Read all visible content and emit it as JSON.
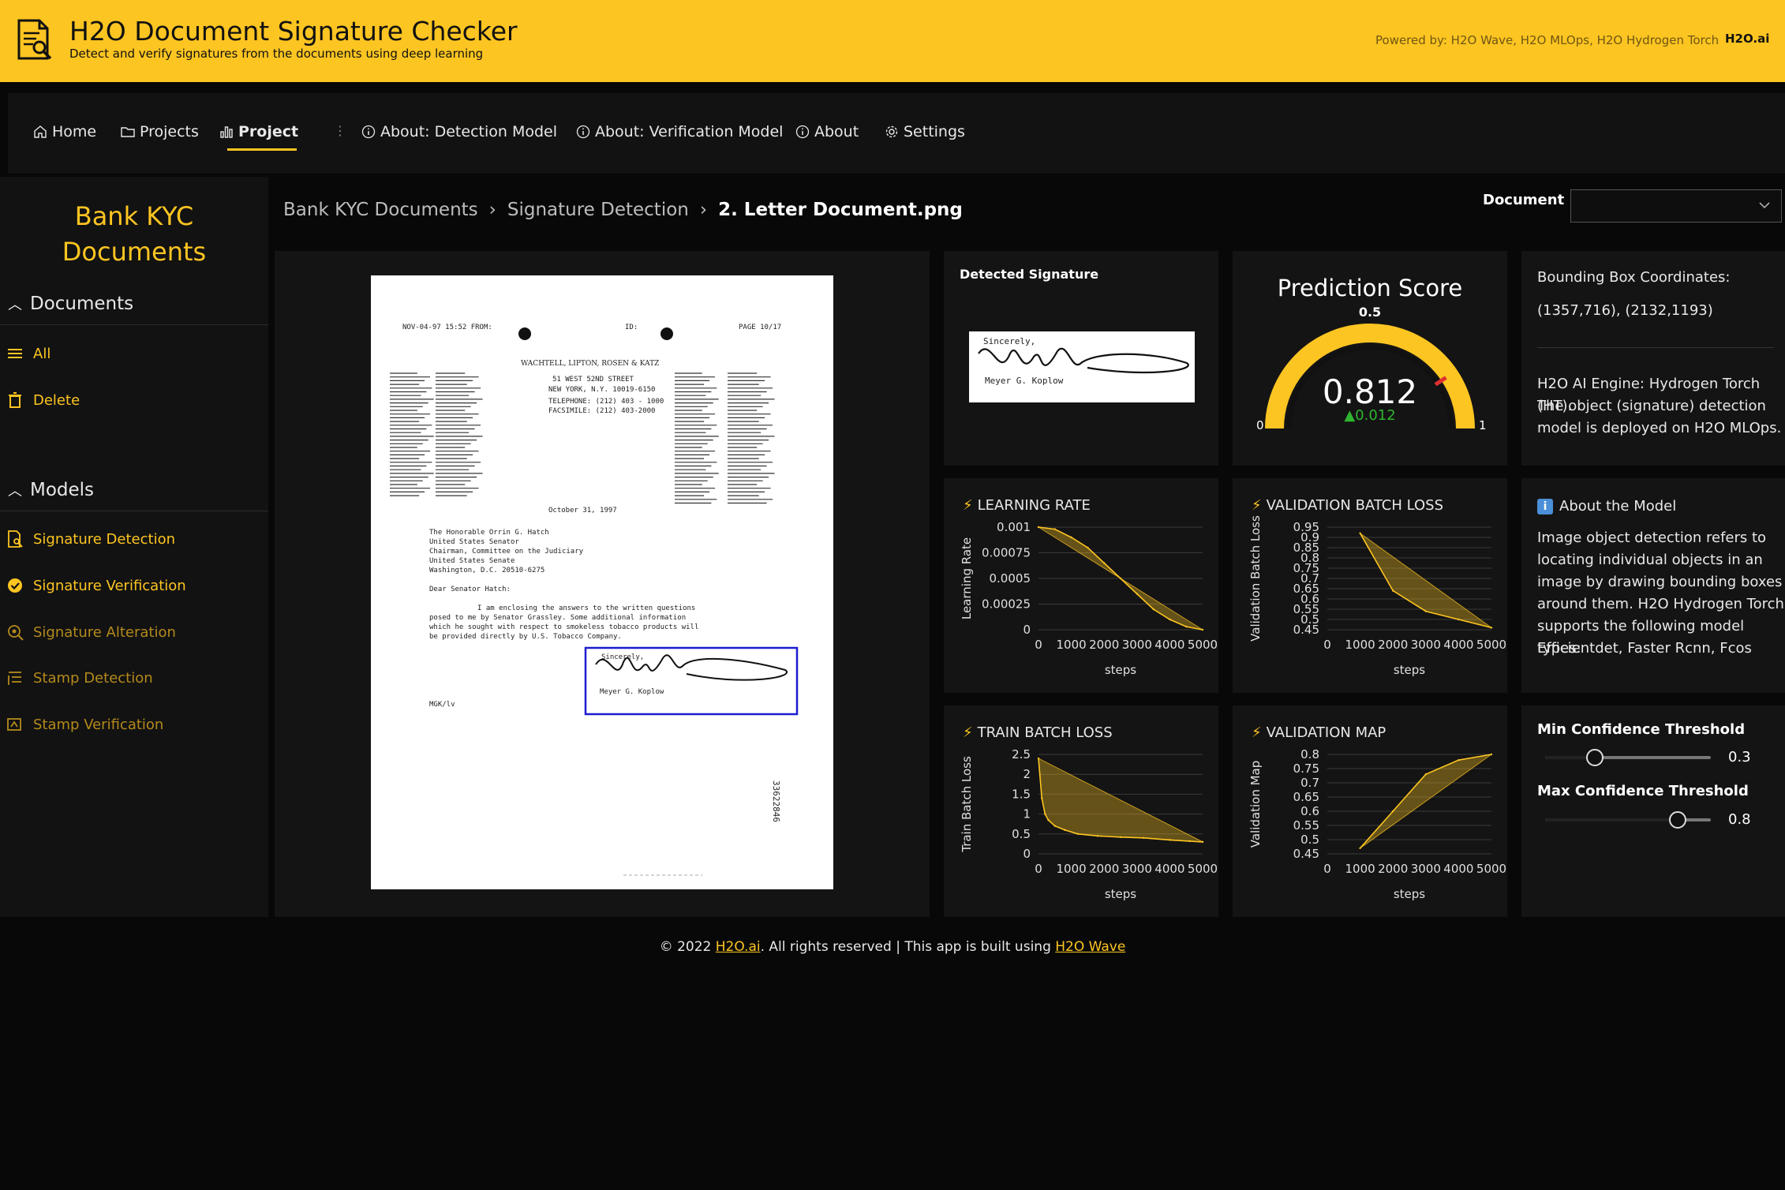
{
  "header": {
    "title": "H2O Document Signature Checker",
    "subtitle": "Detect and verify signatures from the documents using deep learning",
    "powered_by": "Powered by: H2O Wave, H2O MLOps, H2O Hydrogen Torch",
    "brand": "H2O.ai",
    "accent": "#fdc521"
  },
  "nav": {
    "items": [
      {
        "label": "Home",
        "icon": "home-icon"
      },
      {
        "label": "Projects",
        "icon": "folder-icon"
      },
      {
        "label": "Project",
        "icon": "bar-chart-icon",
        "active": true
      },
      {
        "label": "About: Detection Model",
        "icon": "info-icon"
      },
      {
        "label": "About: Verification Model",
        "icon": "info-icon"
      },
      {
        "label": "About",
        "icon": "info-icon"
      },
      {
        "label": "Settings",
        "icon": "gear-icon"
      }
    ]
  },
  "sidebar": {
    "title": "Bank KYC Documents",
    "documents_header": "Documents",
    "doc_links": [
      {
        "label": "All",
        "icon": "list-icon"
      },
      {
        "label": "Delete",
        "icon": "trash-icon"
      }
    ],
    "models_header": "Models",
    "model_links": [
      {
        "label": "Signature Detection",
        "icon": "document-search-icon"
      },
      {
        "label": "Signature Verification",
        "icon": "verified-badge-icon"
      },
      {
        "label": "Signature Alteration",
        "icon": "eye-search-icon"
      },
      {
        "label": "Stamp Detection",
        "icon": "stamp-list-icon"
      },
      {
        "label": "Stamp Verification",
        "icon": "stamp-verify-icon"
      }
    ]
  },
  "breadcrumb": [
    "Bank KYC Documents",
    "Signature Detection",
    "2. Letter Document.png"
  ],
  "document_picker": {
    "label": "Document",
    "value": ""
  },
  "document_image": {
    "header_left": "NOV-04-97 15:52 FROM:",
    "header_mid": "ID:",
    "header_right": "PAGE 10/17",
    "firm": "WACHTELL, LIPTON, ROSEN & KATZ",
    "address1": "51 WEST 52ND STREET",
    "address2": "NEW YORK, N.Y. 10019-6150",
    "phone": "TELEPHONE: (212) 403 - 1000",
    "fax": "FACSIMILE: (212) 403-2000",
    "date": "October 31, 1997",
    "recipient": [
      "The Honorable Orrin G. Hatch",
      "United States Senator",
      "Chairman, Committee on the Judiciary",
      "United States Senate",
      "Washington, D.C.  20510-6275"
    ],
    "salutation": "Dear Senator Hatch:",
    "body": [
      "I am enclosing the answers to the written questions",
      "posed to me by Senator Grassley. Some additional information",
      "which he sought with respect to smokeless tobacco products will",
      "be provided directly by U.S. Tobacco Company."
    ],
    "closing": "Sincerely,",
    "signer": "Meyer G. Koplow",
    "initials": "MGK/lv",
    "bates": "33622846"
  },
  "detected": {
    "title": "Detected Signature",
    "closing": "Sincerely,",
    "signer": "Meyer G. Koplow"
  },
  "prediction": {
    "title": "Prediction Score",
    "target": "0.5",
    "value": "0.812",
    "delta": "▲0.012",
    "min": "0",
    "max": "1",
    "score": 0.812
  },
  "bbox": {
    "title": "Bounding Box Coordinates:",
    "coords": "(1357,716), (2132,1193)",
    "engine": [
      "H2O AI Engine: Hydrogen Torch (HT).",
      "The object (signature) detection",
      "model is deployed on H2O MLOps."
    ]
  },
  "about_model": {
    "title": "About the Model",
    "lines": [
      "Image object detection refers to",
      "locating individual objects in an",
      "image by drawing bounding boxes",
      "around them. H2O Hydrogen Torch",
      "supports the following model types:",
      "Efficientdet, Faster Rcnn, Fcos"
    ]
  },
  "thresholds": {
    "min_label": "Min Confidence Threshold",
    "min_value": 0.3,
    "min_text": "0.3",
    "max_label": "Max Confidence Threshold",
    "max_value": 0.8,
    "max_text": "0.8"
  },
  "footer": {
    "prefix": "© 2022 ",
    "link1": "H2O.ai",
    "middle": ". All rights reserved | This app is built using ",
    "link2": "H2O Wave"
  },
  "chart_data": [
    {
      "type": "area",
      "title": "LEARNING RATE",
      "xlabel": "steps",
      "ylabel": "Learning Rate",
      "xlim": [
        0,
        5000
      ],
      "ylim": [
        0,
        0.001
      ],
      "xticks": [
        "0",
        "1000",
        "2000",
        "3000",
        "4000",
        "5000"
      ],
      "yticks": [
        "0",
        "0.00025",
        "0.0005",
        "0.00075",
        "0.001"
      ],
      "x": [
        0,
        500,
        1000,
        1500,
        2000,
        2500,
        3000,
        3500,
        4000,
        4500,
        5000
      ],
      "series": [
        {
          "values": [
            0.001,
            0.00098,
            0.0009,
            0.0008,
            0.00065,
            0.0005,
            0.00035,
            0.0002,
            0.0001,
            3e-05,
            0
          ]
        }
      ],
      "grid": true
    },
    {
      "type": "area",
      "title": "VALIDATION BATCH LOSS",
      "xlabel": "steps",
      "ylabel": "Validation Batch Loss",
      "xlim": [
        0,
        5000
      ],
      "ylim": [
        0.45,
        0.95
      ],
      "xticks": [
        "0",
        "1000",
        "2000",
        "3000",
        "4000",
        "5000"
      ],
      "yticks": [
        "0.45",
        "0.5",
        "0.55",
        "0.6",
        "0.65",
        "0.7",
        "0.75",
        "0.8",
        "0.85",
        "0.9",
        "0.95"
      ],
      "x": [
        1000,
        2000,
        3000,
        4000,
        5000
      ],
      "series": [
        {
          "values": [
            0.92,
            0.64,
            0.54,
            0.5,
            0.46
          ]
        }
      ],
      "grid": true
    },
    {
      "type": "area",
      "title": "TRAIN BATCH LOSS",
      "xlabel": "steps",
      "ylabel": "Train Batch Loss",
      "xlim": [
        0,
        5000
      ],
      "ylim": [
        0,
        2.5
      ],
      "xticks": [
        "0",
        "1000",
        "2000",
        "3000",
        "4000",
        "5000"
      ],
      "yticks": [
        "0",
        "0.5",
        "1",
        "1.5",
        "2",
        "2.5"
      ],
      "x": [
        0,
        100,
        200,
        300,
        500,
        800,
        1200,
        1800,
        2500,
        3200,
        4000,
        4600,
        5000
      ],
      "series": [
        {
          "values": [
            2.4,
            1.4,
            1.0,
            0.85,
            0.7,
            0.6,
            0.5,
            0.45,
            0.42,
            0.4,
            0.35,
            0.32,
            0.3
          ]
        }
      ],
      "grid": true
    },
    {
      "type": "area",
      "title": "VALIDATION MAP",
      "xlabel": "steps",
      "ylabel": "Validation Map",
      "xlim": [
        0,
        5000
      ],
      "ylim": [
        0.45,
        0.8
      ],
      "xticks": [
        "0",
        "1000",
        "2000",
        "3000",
        "4000",
        "5000"
      ],
      "yticks": [
        "0.45",
        "0.5",
        "0.55",
        "0.6",
        "0.65",
        "0.7",
        "0.75",
        "0.8"
      ],
      "x": [
        1000,
        2000,
        3000,
        4000,
        5000
      ],
      "series": [
        {
          "values": [
            0.47,
            0.6,
            0.73,
            0.78,
            0.8
          ]
        }
      ],
      "grid": true
    }
  ]
}
